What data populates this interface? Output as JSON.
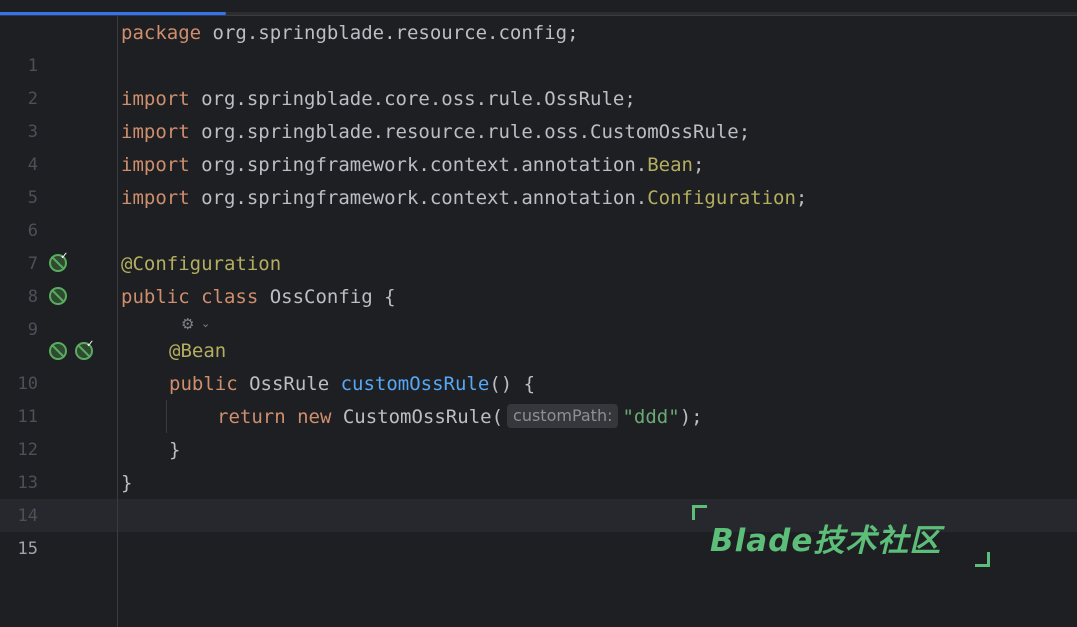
{
  "editor": {
    "lines": [
      {
        "n": "1"
      },
      {
        "n": "2"
      },
      {
        "n": "3"
      },
      {
        "n": "4"
      },
      {
        "n": "5"
      },
      {
        "n": "6"
      },
      {
        "n": "7"
      },
      {
        "n": "8"
      },
      {
        "n": "9"
      },
      {
        "n": "10"
      },
      {
        "n": "11"
      },
      {
        "n": "12"
      },
      {
        "n": "13"
      },
      {
        "n": "14"
      },
      {
        "n": "15"
      }
    ],
    "kw_package": "package",
    "pkg": " org.springblade.resource.config;",
    "kw_import": "import",
    "imp1": " org.springblade.core.oss.rule.OssRule;",
    "imp2": " org.springblade.resource.rule.oss.CustomOssRule;",
    "imp3_pre": " org.springframework.context.annotation.",
    "imp3_cls": "Bean",
    "imp4_pre": " org.springframework.context.annotation.",
    "imp4_cls": "Configuration",
    "semi": ";",
    "ann_config": "@Configuration",
    "kw_public": "public",
    "kw_class": "class",
    "class_rest": " OssConfig {",
    "ann_bean": "@Bean",
    "ret_type": " OssRule ",
    "method_name": "customOssRule",
    "method_rest": "() {",
    "kw_return": "return",
    "kw_new": "new",
    "ctor": " CustomOssRule(",
    "hint_label": "customPath:",
    "str_val": "\"ddd\"",
    "call_end": ");",
    "close_inner": "}",
    "close_outer": "}"
  },
  "progress": {
    "fraction": 0.21
  },
  "watermark": {
    "text": "Blade技术社区"
  },
  "colors": {
    "background": "#1e1f22",
    "keyword": "#cf8e6d",
    "annotation": "#b3ae60",
    "function": "#56a8f5",
    "string": "#6aab73",
    "accent": "#3574f0"
  },
  "icons": [
    "spring-bean-icon",
    "inlay-ai-icon",
    "chevron-down-icon"
  ]
}
